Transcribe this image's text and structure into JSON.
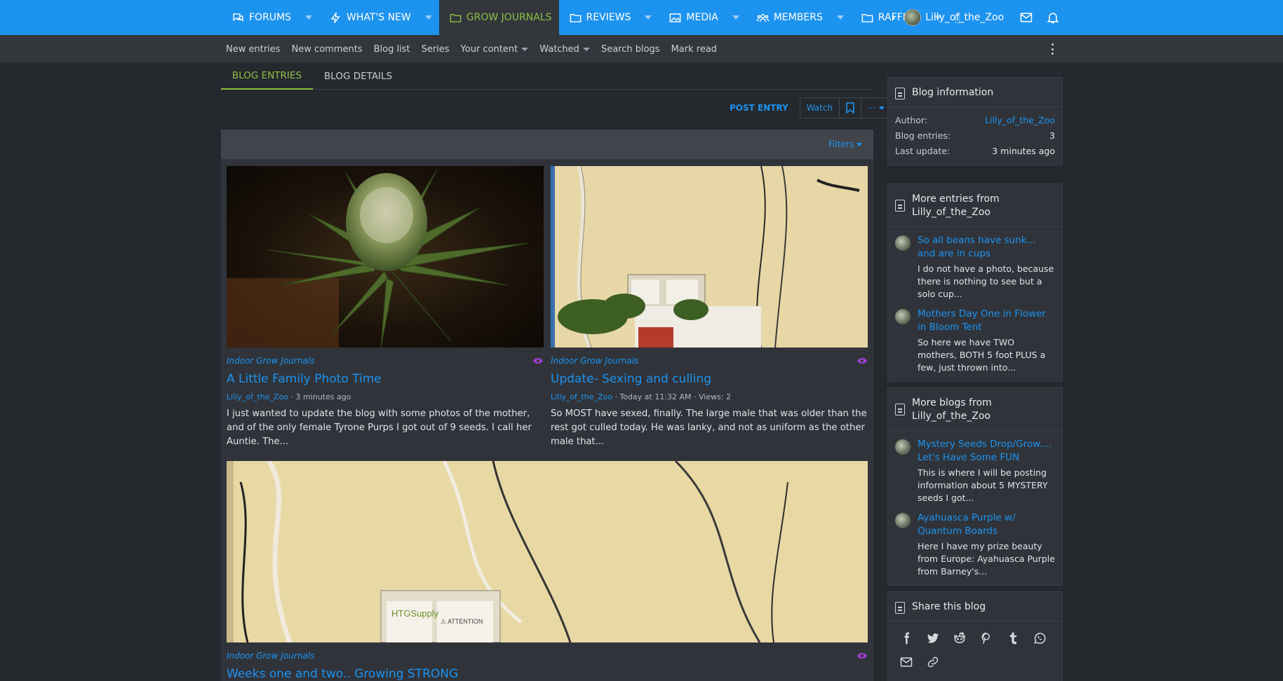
{
  "nav": {
    "items": [
      {
        "label": "Forums",
        "icon": "forums-icon"
      },
      {
        "label": "What's new",
        "icon": "bolt-icon"
      },
      {
        "label": "Grow Journals",
        "icon": "folder-icon",
        "active": true
      },
      {
        "label": "Reviews",
        "icon": "folder-icon"
      },
      {
        "label": "Media",
        "icon": "image-icon"
      },
      {
        "label": "Members",
        "icon": "users-icon"
      },
      {
        "label": "Raffles",
        "icon": "folder-icon"
      }
    ],
    "user": "Lilly_of_the_Zoo",
    "accent": "#1d93f0",
    "active_color": "#8cc04a"
  },
  "subnav": {
    "items": [
      "New entries",
      "New comments",
      "Blog list",
      "Series",
      "Your content",
      "Watched",
      "Search blogs",
      "Mark read"
    ]
  },
  "tabs": [
    "Blog entries",
    "Blog details"
  ],
  "actions": {
    "post_entry": "Post entry",
    "watch": "Watch",
    "more": "···"
  },
  "filters": {
    "label": "Filters"
  },
  "entries": [
    {
      "category": "Indoor Grow Journals",
      "title": "A Little Family Photo Time",
      "author": "Lilly_of_the_Zoo",
      "meta": " · 3 minutes ago",
      "snippet": "I just wanted to update the blog with some photos of the mother, and of the only female Tyrone Purps I got out of 9 seeds. I call her Auntie. The..."
    },
    {
      "category": "Indoor Grow Journals",
      "title": "Update- Sexing and culling",
      "author": "Lilly_of_the_Zoo",
      "meta": " · Today at 11:32 AM · Views: 2",
      "snippet": "So MOST have sexed, finally. The large male that was older than the rest got culled today. He was lanky, and not as uniform as the other male that..."
    },
    {
      "category": "Indoor Grow Journals",
      "title": "Weeks one and two.. Growing STRONG"
    }
  ],
  "sidebar": {
    "blog_info": {
      "title": "Blog information",
      "author_label": "Author:",
      "author": "Lilly_of_the_Zoo",
      "entries_label": "Blog entries:",
      "entries": "3",
      "update_label": "Last update:",
      "update": "3 minutes ago"
    },
    "more_entries": {
      "title": "More entries from Lilly_of_the_Zoo",
      "items": [
        {
          "title": "So all beans have sunk... and are in cups",
          "snippet": "I do not have a photo, because there is nothing to see but a solo cup..."
        },
        {
          "title": "Mothers Day One in Flower in Bloom Tent",
          "snippet": "So here we have TWO mothers, BOTH 5 foot PLUS a few, just thrown into..."
        }
      ]
    },
    "more_blogs": {
      "title": "More blogs from Lilly_of_the_Zoo",
      "items": [
        {
          "title": "Mystery Seeds Drop/Grow.... Let's Have Some FUN",
          "snippet": "This is where I will be posting information about 5 MYSTERY seeds I got..."
        },
        {
          "title": "Ayahuasca Purple w/ Quantum Boards",
          "snippet": "Here I have my prize beauty from Europe: Ayahuasca Purple from Barney's..."
        }
      ]
    },
    "share": {
      "title": "Share this blog",
      "icons": [
        "facebook-icon",
        "twitter-icon",
        "reddit-icon",
        "pinterest-icon",
        "tumblr-icon",
        "whatsapp-icon",
        "email-icon",
        "link-icon"
      ]
    }
  }
}
